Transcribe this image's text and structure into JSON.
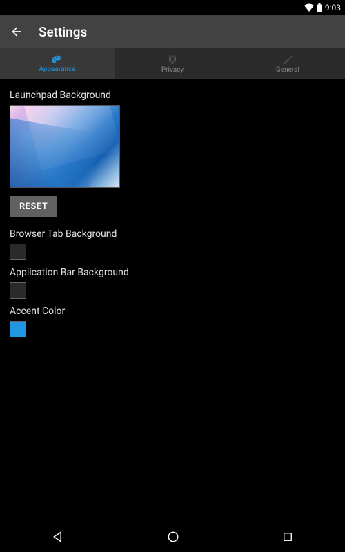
{
  "status": {
    "time": "9:03"
  },
  "appbar": {
    "title": "Settings"
  },
  "tabs": {
    "appearance": "Appearance",
    "privacy": "Privacy",
    "general": "General"
  },
  "sections": {
    "launchpad_bg": "Launchpad Background",
    "reset_label": "RESET",
    "browser_tab_bg": "Browser Tab Background",
    "app_bar_bg": "Application Bar Background",
    "accent_color": "Accent Color"
  },
  "colors": {
    "browser_tab": "#2a2a2a",
    "app_bar": "#2a2a2a",
    "accent": "#2196e3"
  }
}
